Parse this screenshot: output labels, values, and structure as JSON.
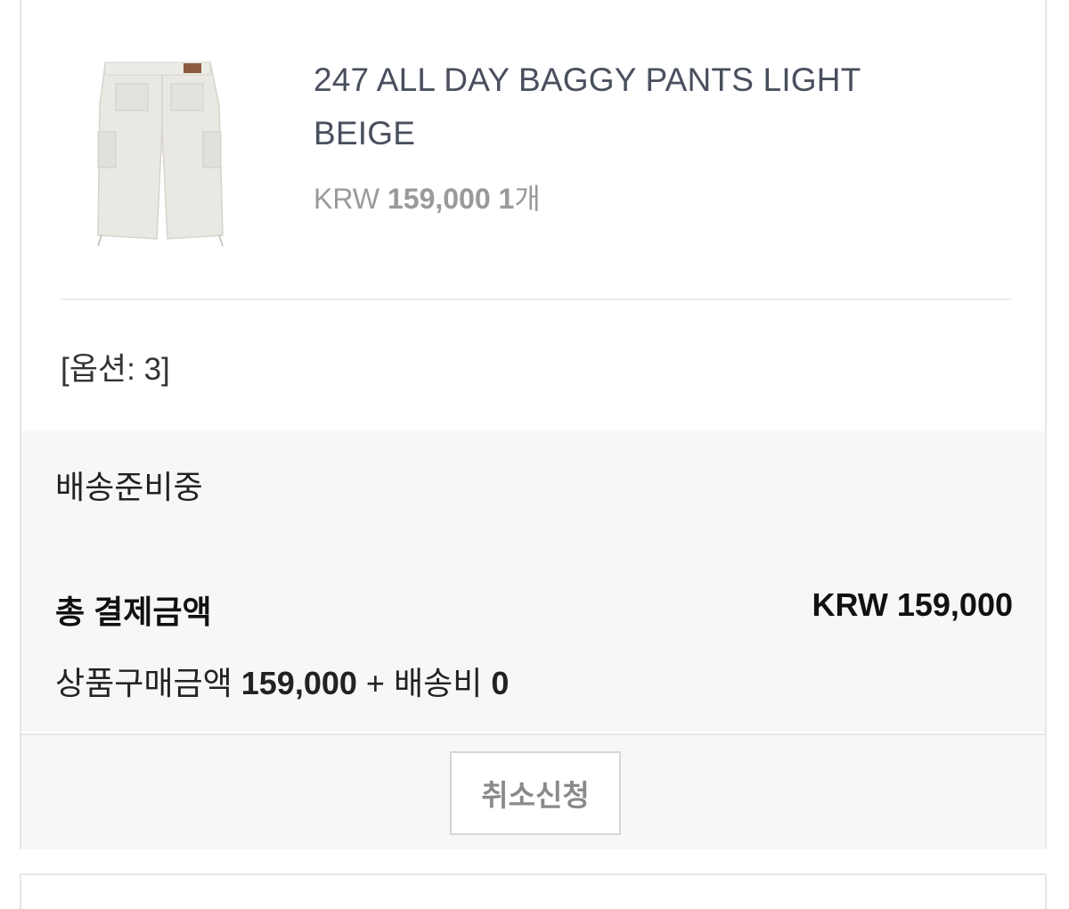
{
  "order_item": {
    "product_name": "247 ALL DAY BAGGY PANTS LIGHT BEIGE",
    "currency": "KRW",
    "price": "159,000",
    "quantity": "1",
    "quantity_unit": "개",
    "image_icon": "baggy-shorts-product-photo",
    "option": "[옵션: 3]"
  },
  "summary": {
    "status": "배송준비중",
    "total_label": "총 결제금액",
    "total_value": "KRW 159,000",
    "product_amount_label": "상품구매금액",
    "product_amount": "159,000",
    "plus_sign": "+",
    "shipping_label": "배송비",
    "shipping_amount": "0"
  },
  "actions": {
    "cancel_label": "취소신청"
  },
  "colors": {
    "title_text": "#4a4f5e",
    "price_text": "#9a9a9a",
    "summary_background": "#f7f7f7",
    "border": "#e6e6e6"
  }
}
